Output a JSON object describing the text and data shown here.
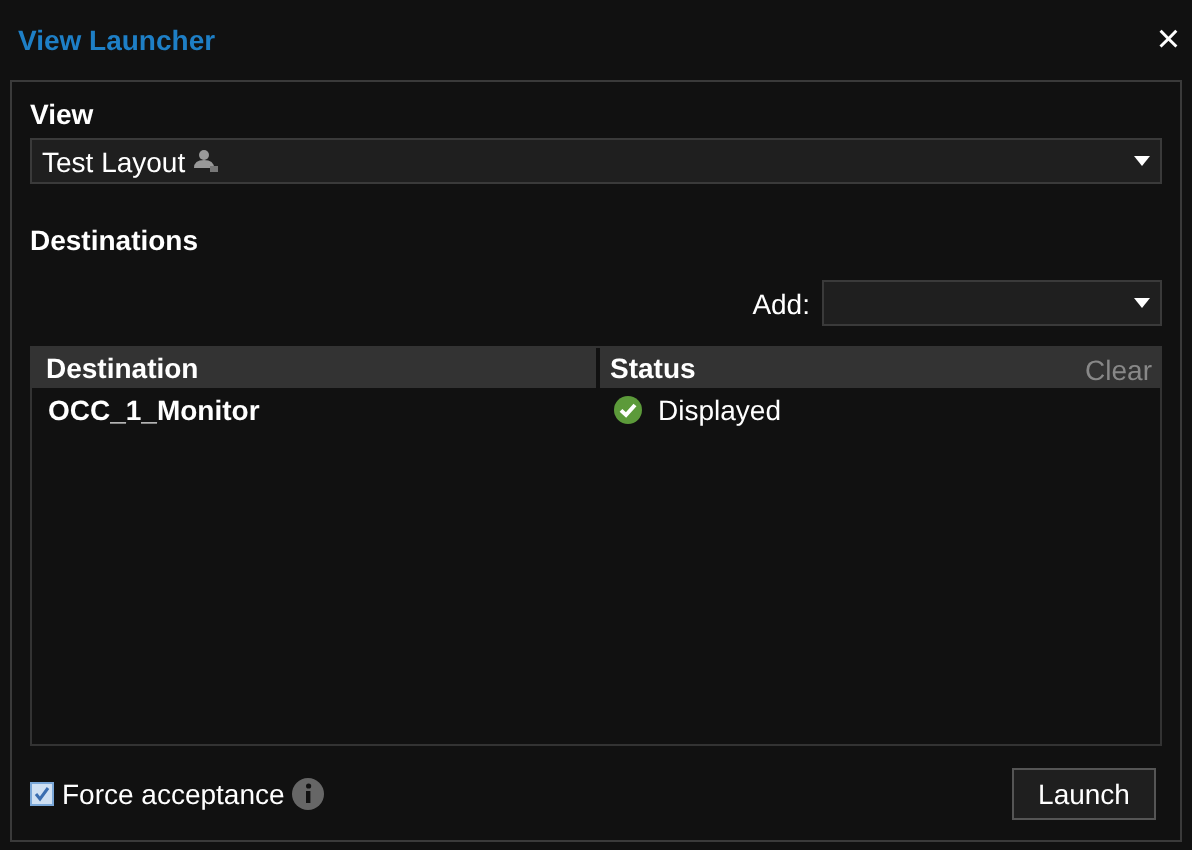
{
  "window": {
    "title": "View Launcher",
    "close": "×"
  },
  "view": {
    "label": "View",
    "value": "Test Layout"
  },
  "destinations": {
    "label": "Destinations",
    "add_label": "Add:"
  },
  "table": {
    "columns": [
      "Destination",
      "Status"
    ],
    "clear": "Clear",
    "rows": [
      {
        "destination": "OCC_1_Monitor",
        "status": "Displayed",
        "kind": "ok"
      }
    ]
  },
  "force_acceptance": {
    "label": "Force acceptance",
    "checked": true
  },
  "buttons": [
    "Launch"
  ]
}
